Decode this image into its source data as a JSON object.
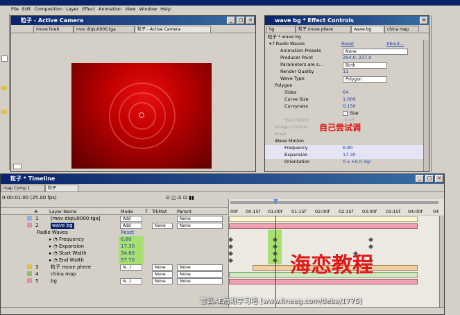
{
  "app": {
    "menu": [
      "File",
      "Edit",
      "Composition",
      "Layer",
      "Effect",
      "Animation",
      "View",
      "Window",
      "Help"
    ]
  },
  "comp": {
    "title": "粒子 - Active Camera",
    "tabs": [
      "move line6",
      "mov diqiu0000.tga",
      "粒子 - Active Camera"
    ]
  },
  "effects": {
    "title": "wave bg * Effect Controls",
    "tabs": [
      "bg",
      "粒子 move phere",
      "wave bg",
      "china map"
    ],
    "header": "粒子 * wave bg",
    "effect_name": "Radio Waves",
    "effect_reset": "Reset",
    "effect_about": "About...",
    "rows": [
      {
        "label": "Animation Presets",
        "value": "None"
      },
      {
        "label": "Producer Point",
        "value": "294.0, 237.0"
      },
      {
        "label": "Parameters are s...",
        "value": "Birth"
      },
      {
        "label": "Render Quality",
        "value": "11"
      },
      {
        "label": "Wave Type",
        "value": "Polygon"
      },
      {
        "label": "Polygon",
        "value": ""
      },
      {
        "label": "Sides",
        "value": "64"
      },
      {
        "label": "Curve Size",
        "value": "1.000"
      },
      {
        "label": "Curvyness",
        "value": "0.150"
      },
      {
        "label": "",
        "value": "Star"
      },
      {
        "label": "Star Depth",
        "value": "-0.43"
      },
      {
        "label": "Image Contour",
        "value": ""
      },
      {
        "label": "Mask",
        "value": ""
      },
      {
        "label": "Wave Motion",
        "value": ""
      },
      {
        "label": "Frequency",
        "value": "6.80"
      },
      {
        "label": "Expansion",
        "value": "17.30"
      },
      {
        "label": "Orientation",
        "value": "0 x +0.0 dgr"
      }
    ],
    "overlay_note": "自己尝试调"
  },
  "timeline": {
    "title": "粒子 * Timeline",
    "tabs": [
      "map Comp 1",
      "粒子"
    ],
    "timecode": "0:00:01:00 (25.00 fps)",
    "col_layer": "Layer Name",
    "col_mode": "Mode",
    "col_t": "T",
    "col_trkmat": "TrkMat",
    "col_parent": "Parent",
    "ruler": [
      "00f",
      "00:15f",
      "01:00f",
      "01:15f",
      "02:00f",
      "02:15f",
      "03:00f",
      "03:15f",
      "04:00f",
      "04"
    ],
    "layers": [
      {
        "num": "1",
        "name": "[mov diqiu0000.tga]",
        "mode": "Add",
        "trk": "",
        "parent": "None"
      },
      {
        "num": "2",
        "name": "wave bg",
        "mode": "Add",
        "trk": "None",
        "parent": "None"
      },
      {
        "num": "3",
        "name": "粒子 move phere",
        "mode": "N...l",
        "trk": "None",
        "parent": "None"
      },
      {
        "num": "4",
        "name": "china map",
        "mode": "",
        "trk": "None",
        "parent": "None"
      },
      {
        "num": "5",
        "name": "bg",
        "mode": "N...l",
        "trk": "None",
        "parent": "None"
      }
    ],
    "effect_group": "Radio Waves",
    "effect_reset": "Reset",
    "props": [
      {
        "name": "Frequency",
        "value": "6.80"
      },
      {
        "name": "Expansion",
        "value": "17.30"
      },
      {
        "name": "Start Width",
        "value": "34.80"
      },
      {
        "name": "End Width",
        "value": "57.70"
      }
    ]
  },
  "watermark": {
    "big": "海恋教程",
    "small": "雪云AE后期学习吧 [www.lineeg.com/tieba/1775]"
  },
  "colors": {
    "titlebar": "#0a246a",
    "highlight": "#a8e070",
    "ruler_red": "#e00000",
    "layer_pink": "#f0a0b0"
  }
}
